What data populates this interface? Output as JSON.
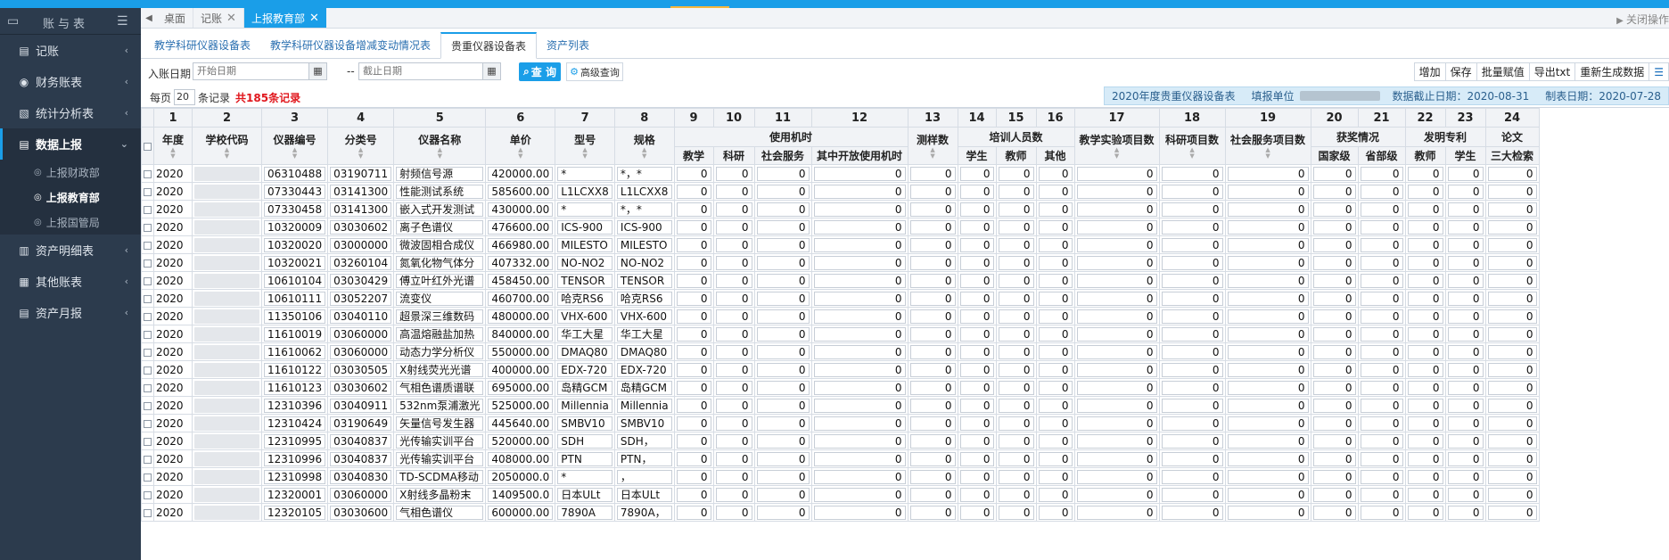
{
  "sidebar": {
    "title": "账与表",
    "items": [
      {
        "label": "记账",
        "icon": "book-icon"
      },
      {
        "label": "财务账表",
        "icon": "coin-icon"
      },
      {
        "label": "统计分析表",
        "icon": "report-icon"
      },
      {
        "label": "数据上报",
        "icon": "upload-icon",
        "active": true
      },
      {
        "label": "资产明细表",
        "icon": "asset-icon"
      },
      {
        "label": "其他账表",
        "icon": "other-icon"
      },
      {
        "label": "资产月报",
        "icon": "monthly-icon"
      }
    ],
    "subitems": [
      "上报财政部",
      "上报教育部",
      "上报国管局"
    ]
  },
  "page_tabs": [
    {
      "label": "桌面"
    },
    {
      "label": "记账"
    },
    {
      "label": "上报教育部",
      "active": true
    }
  ],
  "close_ops": "关闭操作",
  "sub_tabs": [
    "教学科研仪器设备表",
    "教学科研仪器设备增减变动情况表",
    "贵重仪器设备表",
    "资产列表"
  ],
  "filter": {
    "label": "入账日期",
    "start_placeholder": "开始日期",
    "dash": "--",
    "end_placeholder": "截止日期",
    "query_label": "查 询",
    "advanced_label": "高级查询"
  },
  "toolbar": [
    "增加",
    "保存",
    "批量赋值",
    "导出txt",
    "重新生成数据"
  ],
  "pager": {
    "prefix": "每页",
    "page_size": "20",
    "suffix": "条记录",
    "total": "共185条记录"
  },
  "info": {
    "title": "2020年度贵重仪器设备表",
    "unit_label": "填报单位",
    "deadline": "数据截止日期：2020-08-31",
    "made": "制表日期：2020-07-28"
  },
  "table": {
    "col_numbers": [
      "1",
      "2",
      "3",
      "4",
      "5",
      "6",
      "7",
      "8",
      "9",
      "10",
      "11",
      "12",
      "13",
      "14",
      "15",
      "16",
      "17",
      "18",
      "19",
      "20",
      "21",
      "22",
      "23",
      "24"
    ],
    "headers": {
      "year": "年度",
      "school": "学校代码",
      "device_no": "仪器编号",
      "class_no": "分类号",
      "name": "仪器名称",
      "price": "单价",
      "model": "型号",
      "spec": "规格",
      "machine_time": "使用机时",
      "teaching": "教学",
      "research": "科研",
      "social": "社会服务",
      "open": "其中开放使用机时",
      "samples": "测样数",
      "train": "培训人员数",
      "student": "学生",
      "teacher": "教师",
      "other": "其他",
      "exp_projects": "教学实验项目数",
      "res_projects": "科研项目数",
      "svc_projects": "社会服务项目数",
      "awards": "获奖情况",
      "national": "国家级",
      "provincial": "省部级",
      "patents": "发明专利",
      "p_teacher": "教师",
      "p_student": "学生",
      "papers": "论文",
      "three_index": "三大检索"
    },
    "rows": [
      {
        "year": "2020",
        "device_no": "06310488",
        "class_no": "03190711",
        "name": "射频信号源",
        "price": "420000.00",
        "model": "*",
        "spec": "*，*"
      },
      {
        "year": "2020",
        "device_no": "07330443",
        "class_no": "03141300",
        "name": "性能测试系统",
        "price": "585600.00",
        "model": "L1LCXX8",
        "spec": "L1LCXX8"
      },
      {
        "year": "2020",
        "device_no": "07330458",
        "class_no": "03141300",
        "name": "嵌入式开发测试",
        "price": "430000.00",
        "model": "*",
        "spec": "*，*"
      },
      {
        "year": "2020",
        "device_no": "10320009",
        "class_no": "03030602",
        "name": "离子色谱仪",
        "price": "476600.00",
        "model": "ICS-900",
        "spec": "ICS-900"
      },
      {
        "year": "2020",
        "device_no": "10320020",
        "class_no": "03000000",
        "name": "微波固相合成仪",
        "price": "466980.00",
        "model": "MILESTO",
        "spec": "MILESTO"
      },
      {
        "year": "2020",
        "device_no": "10320021",
        "class_no": "03260104",
        "name": "氮氧化物气体分",
        "price": "407332.00",
        "model": "NO-NO2",
        "spec": "NO-NO2"
      },
      {
        "year": "2020",
        "device_no": "10610104",
        "class_no": "03030429",
        "name": "傅立叶红外光谱",
        "price": "458450.00",
        "model": "TENSOR",
        "spec": "TENSOR"
      },
      {
        "year": "2020",
        "device_no": "10610111",
        "class_no": "03052207",
        "name": "流变仪",
        "price": "460700.00",
        "model": "哈克RS6",
        "spec": "哈克RS6"
      },
      {
        "year": "2020",
        "device_no": "11350106",
        "class_no": "03040110",
        "name": "超景深三维数码",
        "price": "480000.00",
        "model": "VHX-600",
        "spec": "VHX-600"
      },
      {
        "year": "2020",
        "device_no": "11610019",
        "class_no": "03060000",
        "name": "高温熔融盐加热",
        "price": "840000.00",
        "model": "华工大星",
        "spec": "华工大星"
      },
      {
        "year": "2020",
        "device_no": "11610062",
        "class_no": "03060000",
        "name": "动态力学分析仪",
        "price": "550000.00",
        "model": "DMAQ80",
        "spec": "DMAQ80"
      },
      {
        "year": "2020",
        "device_no": "11610122",
        "class_no": "03030505",
        "name": "X射线荧光光谱",
        "price": "400000.00",
        "model": "EDX-720",
        "spec": "EDX-720"
      },
      {
        "year": "2020",
        "device_no": "11610123",
        "class_no": "03030602",
        "name": "气相色谱质谱联",
        "price": "695000.00",
        "model": "岛精GCM",
        "spec": "岛精GCM"
      },
      {
        "year": "2020",
        "device_no": "12310396",
        "class_no": "03040911",
        "name": "532nm泵浦激光",
        "price": "525000.00",
        "model": "Millennia",
        "spec": "Millennia"
      },
      {
        "year": "2020",
        "device_no": "12310424",
        "class_no": "03190649",
        "name": "矢量信号发生器",
        "price": "445640.00",
        "model": "SMBV10",
        "spec": "SMBV10"
      },
      {
        "year": "2020",
        "device_no": "12310995",
        "class_no": "03040837",
        "name": "光传输实训平台",
        "price": "520000.00",
        "model": "SDH",
        "spec": "SDH，"
      },
      {
        "year": "2020",
        "device_no": "12310996",
        "class_no": "03040837",
        "name": "光传输实训平台",
        "price": "408000.00",
        "model": "PTN",
        "spec": "PTN，"
      },
      {
        "year": "2020",
        "device_no": "12310998",
        "class_no": "03040830",
        "name": "TD-SCDMA移动",
        "price": "2050000.0",
        "model": "*",
        "spec": "，"
      },
      {
        "year": "2020",
        "device_no": "12320001",
        "class_no": "03060000",
        "name": "X射线多晶粉末",
        "price": "1409500.0",
        "model": "日本ULt",
        "spec": "日本ULt"
      },
      {
        "year": "2020",
        "device_no": "12320105",
        "class_no": "03030600",
        "name": "气相色谱仪",
        "price": "600000.00",
        "model": "7890A",
        "spec": "7890A，"
      }
    ],
    "zero": "0"
  }
}
